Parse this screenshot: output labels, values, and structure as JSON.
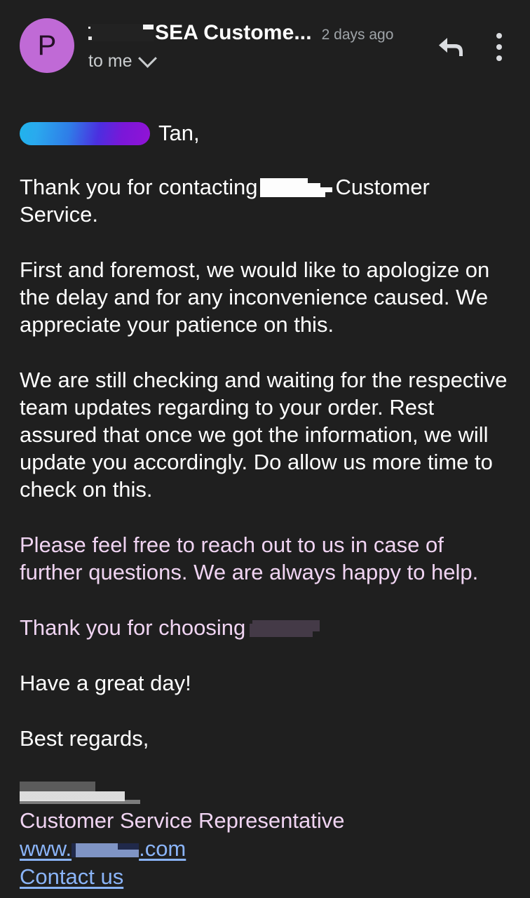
{
  "theme": {
    "background": "#1f1f1f",
    "text_primary": "#ffffff",
    "text_secondary": "#9fa4a8",
    "accent_purple_text": "#f0d4f2",
    "link_blue": "#8ab4f8",
    "avatar_bg": "#c06ad6"
  },
  "header": {
    "avatar_initial": "P",
    "sender_name": "SEA Custome...",
    "sender_redacted": true,
    "date": "2 days ago",
    "recipient": "to me",
    "recipient_chevron_icon": "chevron-down-icon",
    "reply_icon": "reply-arrow-icon",
    "more_icon": "more-vertical-icon"
  },
  "body": {
    "greeting_redacted_name": true,
    "greeting_suffix": "Tan,",
    "paragraphs": [
      {
        "id": "thanks",
        "color": "white",
        "before_redaction": "Thank you for contacting",
        "redaction": "white-block",
        "after_redaction": "Customer Service."
      },
      {
        "id": "apology",
        "color": "white",
        "text": "First and foremost, we would like to apologize on the delay and for any inconvenience caused. We appreciate your patience on this."
      },
      {
        "id": "status",
        "color": "white",
        "text": "We are still checking and waiting for the respective team updates regarding to your order. Rest assured that once we got the information, we will update you accordingly. Do allow us more time to check on this."
      },
      {
        "id": "reach-out",
        "color": "purple",
        "text": "Please feel free to reach out to us in case of further questions. We are always happy to help."
      },
      {
        "id": "thank-you-choosing",
        "color": "purple",
        "before_redaction": "Thank you for choosing",
        "redaction": "dark-block"
      },
      {
        "id": "great-day",
        "color": "white",
        "text": "Have a great day!"
      },
      {
        "id": "best-regards",
        "color": "white",
        "text": "Best regards,"
      }
    ]
  },
  "signature": {
    "name_redacted": true,
    "role": "Customer Service Representative",
    "website_prefix": "www.",
    "website_suffix": ".com",
    "website_redacted": true,
    "contact_link": "Contact us"
  }
}
